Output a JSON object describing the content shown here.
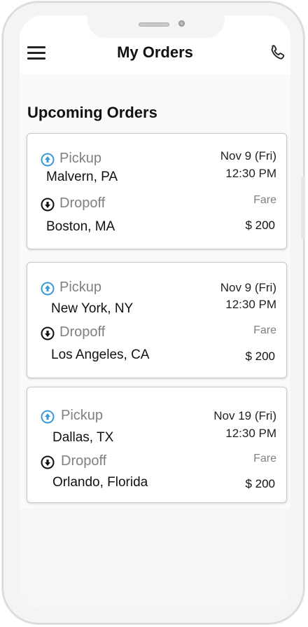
{
  "header": {
    "title": "My Orders"
  },
  "section": {
    "title": "Upcoming Orders"
  },
  "labels": {
    "pickup": "Pickup",
    "dropoff": "Dropoff",
    "fare": "Fare"
  },
  "icons": {
    "menu": "hamburger-menu-icon",
    "call": "phone-icon",
    "pickup": "pickup-arrow-up-icon",
    "dropoff": "dropoff-arrow-down-icon"
  },
  "colors": {
    "pickup_icon": "#3a9ad9",
    "dropoff_icon": "#111111"
  },
  "orders": [
    {
      "pickup_location": "Malvern, PA",
      "dropoff_location": "Boston, MA",
      "date": "Nov 9 (Fri)",
      "time": "12:30 PM",
      "fare": "$ 200"
    },
    {
      "pickup_location": "New York, NY",
      "dropoff_location": "Los Angeles, CA",
      "date": "Nov 9 (Fri)",
      "time": "12:30 PM",
      "fare": "$ 200"
    },
    {
      "pickup_location": "Dallas, TX",
      "dropoff_location": "Orlando, Florida",
      "date": "Nov 19 (Fri)",
      "time": "12:30 PM",
      "fare": "$ 200"
    }
  ]
}
